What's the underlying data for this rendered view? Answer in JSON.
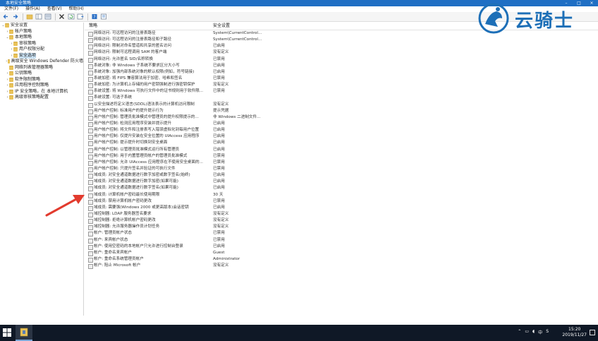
{
  "window": {
    "title": "本地安全策略"
  },
  "menu": [
    "文件(F)",
    "操作(A)",
    "查看(V)",
    "帮助(H)"
  ],
  "tree": [
    {
      "label": "安全设置",
      "arrow": "⌄",
      "indent": 0
    },
    {
      "label": "帐户策略",
      "arrow": "›",
      "indent": 1
    },
    {
      "label": "本地策略",
      "arrow": "⌄",
      "indent": 1
    },
    {
      "label": "审核策略",
      "arrow": "›",
      "indent": 2
    },
    {
      "label": "用户权限分配",
      "arrow": "›",
      "indent": 2
    },
    {
      "label": "安全选项",
      "arrow": "›",
      "indent": 2,
      "selected": true
    },
    {
      "label": "高级安全 Windows Defender 防火墙",
      "arrow": "›",
      "indent": 1
    },
    {
      "label": "网络列表管理器策略",
      "arrow": "",
      "indent": 1
    },
    {
      "label": "公钥策略",
      "arrow": "›",
      "indent": 1
    },
    {
      "label": "软件限制策略",
      "arrow": "›",
      "indent": 1
    },
    {
      "label": "应用程序控制策略",
      "arrow": "›",
      "indent": 1
    },
    {
      "label": "IP 安全策略，在 本地计算机",
      "arrow": "›",
      "indent": 1
    },
    {
      "label": "高级审核策略配置",
      "arrow": "›",
      "indent": 1
    }
  ],
  "columns": {
    "policy": "策略",
    "setting": "安全设置"
  },
  "policies": [
    {
      "name": "网络访问: 可远程访问的注册表路径",
      "value": "System\\CurrentControl..."
    },
    {
      "name": "网络访问: 可远程访问的注册表路径和子路径",
      "value": "System\\CurrentControl..."
    },
    {
      "name": "网络访问: 限制对命名管道和共享的匿名访问",
      "value": "已启用"
    },
    {
      "name": "网络访问: 限制可远程调用 SAM 的客户端",
      "value": "没有定义"
    },
    {
      "name": "网络访问: 允许匿名 SID/名称转换",
      "value": "已禁用"
    },
    {
      "name": "系统对象: 非 Windows 子系统不要求区分大小写",
      "value": "已启用"
    },
    {
      "name": "系统对象: 加强内部系统对象的默认权限(例如，符号链接)",
      "value": "已启用"
    },
    {
      "name": "系统加密: 将 FIPS 兼容算法用于加密、哈希和签名",
      "value": "已禁用"
    },
    {
      "name": "系统加密: 为计算机上存储的用户密钥强制进行强密钥保护",
      "value": "没有定义"
    },
    {
      "name": "系统设置: 将 Windows 可执行文件中的证书规则用于软件限...",
      "value": "已禁用"
    },
    {
      "name": "系统设置: 可选子系统",
      "value": ""
    },
    {
      "name": "以安全描述符定义语言(SDDL)语法表示的计算机访问限制",
      "value": "没有定义"
    },
    {
      "name": "用户帐户控制: 标准用户的提升提示行为",
      "value": "提示凭据"
    },
    {
      "name": "用户帐户控制: 管理员批准模式中管理员的提升权限提示的...",
      "value": "非 Windows 二进制文件..."
    },
    {
      "name": "用户帐户控制: 检测应用程序安装并提示提升",
      "value": "已启用"
    },
    {
      "name": "用户帐户控制: 将文件和注册表写入错误虚拟化到每用户位置",
      "value": "已启用"
    },
    {
      "name": "用户帐户控制: 仅提升安装在安全位置的 UIAccess 应用程序",
      "value": "已启用"
    },
    {
      "name": "用户帐户控制: 提示提升时切换到安全桌面",
      "value": "已启用"
    },
    {
      "name": "用户帐户控制: 以管理员批准模式运行所有管理员",
      "value": "已启用"
    },
    {
      "name": "用户帐户控制: 用于内置管理员帐户的管理员批准模式",
      "value": "已禁用"
    },
    {
      "name": "用户帐户控制: 允许 UIAccess 应用程序在不使用安全桌面的...",
      "value": "已禁用"
    },
    {
      "name": "用户帐户控制: 只提升签名并验证的可执行文件",
      "value": "已禁用"
    },
    {
      "name": "域成员: 对安全通道数据进行数字加密或数字签名(始终)",
      "value": "已启用"
    },
    {
      "name": "域成员: 对安全通道数据进行数字加密(如果可能)",
      "value": "已启用"
    },
    {
      "name": "域成员: 对安全通道数据进行数字签名(如果可能)",
      "value": "已启用"
    },
    {
      "name": "域成员: 计算机帐户密码最长使用期限",
      "value": "30 天"
    },
    {
      "name": "域成员: 禁用计算机帐户密码更改",
      "value": "已禁用"
    },
    {
      "name": "域成员: 需要强(Windows 2000 或更高版本)会话密钥",
      "value": "已启用"
    },
    {
      "name": "域控制器: LDAP 服务器签名要求",
      "value": "没有定义"
    },
    {
      "name": "域控制器: 拒绝计算机帐户密码更改",
      "value": "没有定义"
    },
    {
      "name": "域控制器: 允许服务器操作员计划任务",
      "value": "没有定义"
    },
    {
      "name": "帐户: 管理员帐户状态",
      "value": "已禁用"
    },
    {
      "name": "帐户: 来宾帐户状态",
      "value": "已禁用"
    },
    {
      "name": "帐户: 使用空密码的本地帐户只允许进行控制台登录",
      "value": "已启用"
    },
    {
      "name": "帐户: 重命名来宾帐户",
      "value": "Guest"
    },
    {
      "name": "帐户: 重命名系统管理员帐户",
      "value": "Administrator"
    },
    {
      "name": "帐户: 阻止 Microsoft 帐户",
      "value": "没有定义"
    }
  ],
  "logo": {
    "text": "云骑士"
  },
  "taskbar": {
    "time": "15:20",
    "date": "2019/11/27",
    "lang": "中",
    "ime": "S"
  },
  "colors": {
    "titlebar": "#1f6fc4",
    "arrow": "#e23b2e",
    "logo": "#1d6fb7",
    "taskbar": "#0f1826"
  }
}
